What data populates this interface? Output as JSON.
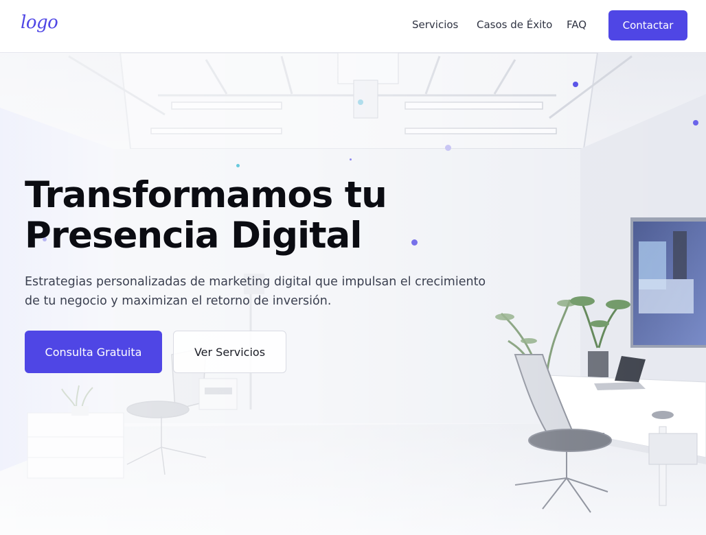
{
  "header": {
    "logo_text": "logo",
    "nav": {
      "services": "Servicios",
      "cases": "Casos de Éxito",
      "faq": "FAQ"
    },
    "contact_label": "Contactar"
  },
  "hero": {
    "title_line1": "Transformamos tu",
    "title_line2": "Presencia Digital",
    "subtitle_line1": "Estrategias personalizadas de marketing digital que impulsan el crecimiento",
    "subtitle_line2": "de tu negocio y maximizan el retorno de inversión.",
    "primary_cta": "Consulta Gratuita",
    "secondary_cta": "Ver Servicios",
    "background_image": "modern-office-illustration"
  },
  "colors": {
    "accent": "#4f46e5",
    "title": "#0b0c12",
    "body_text": "#3a3f4f"
  }
}
